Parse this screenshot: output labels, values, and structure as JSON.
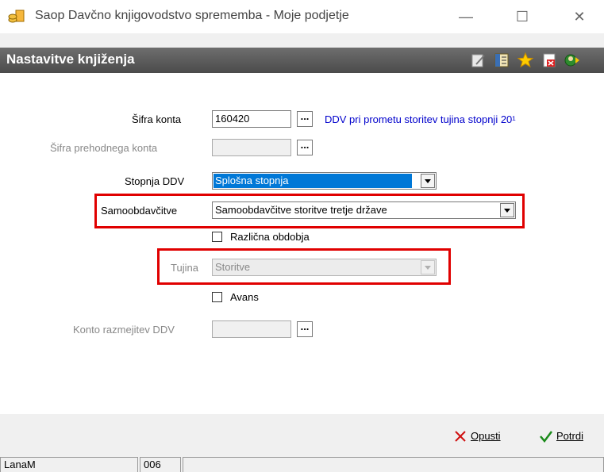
{
  "window": {
    "title": "Saop Davčno knjigovodstvo sprememba - Moje podjetje",
    "minimize_glyph": "—",
    "maximize_glyph": "☐",
    "close_glyph": "✕"
  },
  "header": {
    "title": "Nastavitve knjiženja",
    "icons": [
      "edit-icon",
      "list-icon",
      "star-icon",
      "delete-icon",
      "user-icon"
    ]
  },
  "form": {
    "sifra_konta": {
      "label": "Šifra konta",
      "value": "160420",
      "lookup": "...",
      "description": "DDV pri prometu storitev tujina stopnji 20¹"
    },
    "sifra_prehodnega": {
      "label": "Šifra prehodnega konta",
      "value": "",
      "lookup": "..."
    },
    "stopnja_ddv": {
      "label": "Stopnja DDV",
      "value": "Splošna stopnja"
    },
    "samoobdavcitve": {
      "label": "Samoobdavčitve",
      "value": "Samoobdavčitve storitve tretje države"
    },
    "razlicna_obdobja": {
      "label": "Različna obdobja",
      "checked": false
    },
    "tujina": {
      "label": "Tujina",
      "value": "Storitve"
    },
    "avans": {
      "label": "Avans",
      "checked": false
    },
    "konto_razmejitev": {
      "label": "Konto razmejitev DDV",
      "value": "",
      "lookup": "..."
    }
  },
  "buttons": {
    "cancel_label": "Opusti",
    "confirm_label": "Potrdi"
  },
  "statusbar": {
    "user": "LanaM",
    "code": "006",
    "info": ""
  },
  "colors": {
    "highlight": "#e00000",
    "selection": "#0078d7",
    "header_bg": "#5a5a5a",
    "description_text": "#0000cc"
  }
}
